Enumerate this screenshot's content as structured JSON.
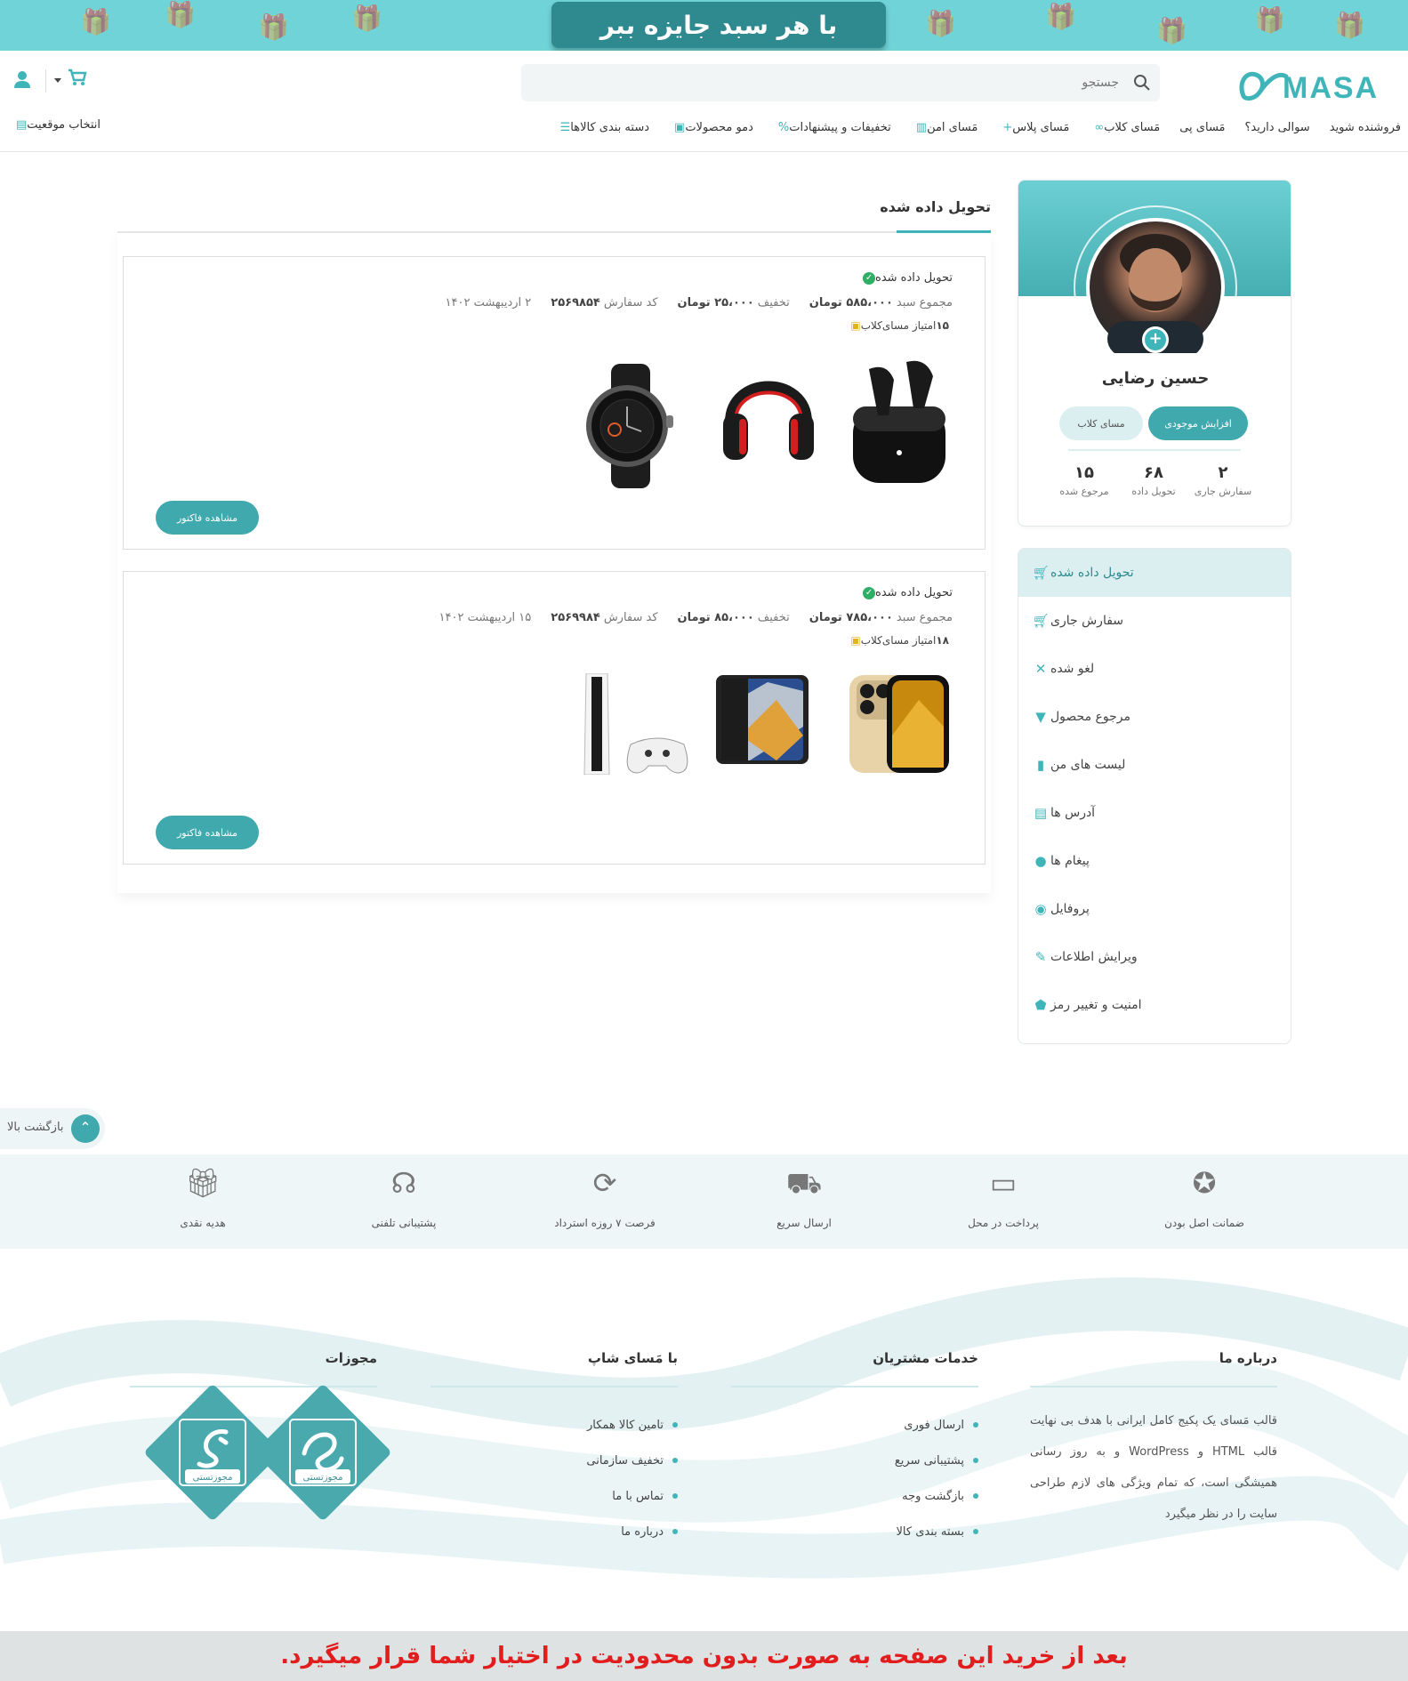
{
  "banner": {
    "text": "با هر سبد جایزه ببر"
  },
  "header": {
    "logo": "MASAI",
    "search_placeholder": "جستجو",
    "location_label": "انتخاب موقعیت"
  },
  "nav": [
    {
      "label": "دسته بندی کالاها",
      "icon": "menu-icon"
    },
    {
      "label": "دمو محصولات",
      "icon": "film-icon"
    },
    {
      "label": "تخفیفات و پیشنهادات",
      "icon": "percent-icon"
    },
    {
      "label": "مَسای امن",
      "icon": "building-icon"
    },
    {
      "label": "مَسای پلاس",
      "icon": "plus-icon"
    },
    {
      "label": "مَسای کلاب",
      "icon": "link-icon"
    },
    {
      "label": "مَسای پی",
      "icon": ""
    },
    {
      "label": "سوالی دارید؟",
      "icon": ""
    },
    {
      "label": "فروشنده شوید",
      "icon": ""
    }
  ],
  "profile": {
    "name": "حسین رضایی",
    "btn_wallet": "افزایش موجودی",
    "btn_club": "مسای کلاب",
    "stats": [
      {
        "num": "۲",
        "label": "سفارش جاری"
      },
      {
        "num": "۶۸",
        "label": "تحویل داده"
      },
      {
        "num": "۱۵",
        "label": "مرجوع شده"
      }
    ]
  },
  "menu": [
    {
      "label": "تحویل داده شده",
      "icon": "cart-icon",
      "active": true
    },
    {
      "label": "سفارش جاری",
      "icon": "cart-icon"
    },
    {
      "label": "لغو شده",
      "icon": "close-icon"
    },
    {
      "label": "مرجوع محصول",
      "icon": "thumbs-down-icon"
    },
    {
      "label": "لیست های من",
      "icon": "bookmark-icon"
    },
    {
      "label": "آدرس ها",
      "icon": "map-icon"
    },
    {
      "label": "پیغام ها",
      "icon": "bell-icon"
    },
    {
      "label": "پروفایل",
      "icon": "user-icon"
    },
    {
      "label": "ویرایش اطلاعات",
      "icon": "pencil-icon"
    },
    {
      "label": "امنیت و تغییر رمز",
      "icon": "shield-icon"
    }
  ],
  "main": {
    "title": "تحویل داده شده"
  },
  "orders": [
    {
      "status": "تحویل داده شده",
      "date": "۲ اردیبهشت ۱۴۰۲",
      "code_label": "کد سفارش",
      "code": "۲۵۶۹۸۵۴",
      "discount_label": "تخفیف",
      "discount": "۲۵،۰۰۰ تومان",
      "total_label": "مجموع سبد",
      "total": "۵۸۵،۰۰۰ تومان",
      "score_label": "امتیاز مسای‌کلاب",
      "score": "۱۵",
      "invoice_label": "مشاهده فاکتور",
      "products": [
        "earbuds",
        "headphones",
        "smartwatch"
      ]
    },
    {
      "status": "تحویل داده شده",
      "date": "۱۵ اردیبهشت ۱۴۰۲",
      "code_label": "کد سفارش",
      "code": "۲۵۶۹۹۸۴",
      "discount_label": "تخفیف",
      "discount": "۸۵،۰۰۰ تومان",
      "total_label": "مجموع سبد",
      "total": "۷۸۵،۰۰۰ تومان",
      "score_label": "امتیاز مسای‌کلاب",
      "score": "۱۸",
      "invoice_label": "مشاهده فاکتور",
      "products": [
        "iphone",
        "android-phone",
        "game-console"
      ]
    }
  ],
  "back_to_top": "بازگشت بالا",
  "features": [
    {
      "label": "ضمانت اصل بودن",
      "icon": "medal-icon"
    },
    {
      "label": "پرداخت در محل",
      "icon": "card-icon"
    },
    {
      "label": "ارسال سریع",
      "icon": "truck-icon"
    },
    {
      "label": "فرصت ۷ روزه استرداد",
      "icon": "return-7-icon"
    },
    {
      "label": "پشتیبانی تلفنی",
      "icon": "headset-icon"
    },
    {
      "label": "هدیه نقدی",
      "icon": "gift-icon"
    }
  ],
  "footer": {
    "about_title": "درباره ما",
    "about_text": "قالب مَسای یک پکیج کامل ایرانی با هدف بی نهایت قالب HTML و WordPress و به روز رسانی همیشگی است، که تمام ویژگی های لازم طراحی سایت را در نظر میگیرد",
    "services_title": "خدمات مشتریان",
    "services": [
      "ارسال فوری",
      "پشتیبانی سریع",
      "بازگشت وجه",
      "بسته بندی کالا"
    ],
    "shop_title": "با مَسای شاپ",
    "shop": [
      "تامین کالا همکار",
      "تخفیف سازمانی",
      "تماس با ما",
      "درباره ما"
    ],
    "licenses_title": "مجوزات",
    "badge_text": "مجوزتستی"
  },
  "bottom_notice": "بعد از خرید این صفحه به صورت بدون محدودیت در اختیار شما قرار میگیرد."
}
